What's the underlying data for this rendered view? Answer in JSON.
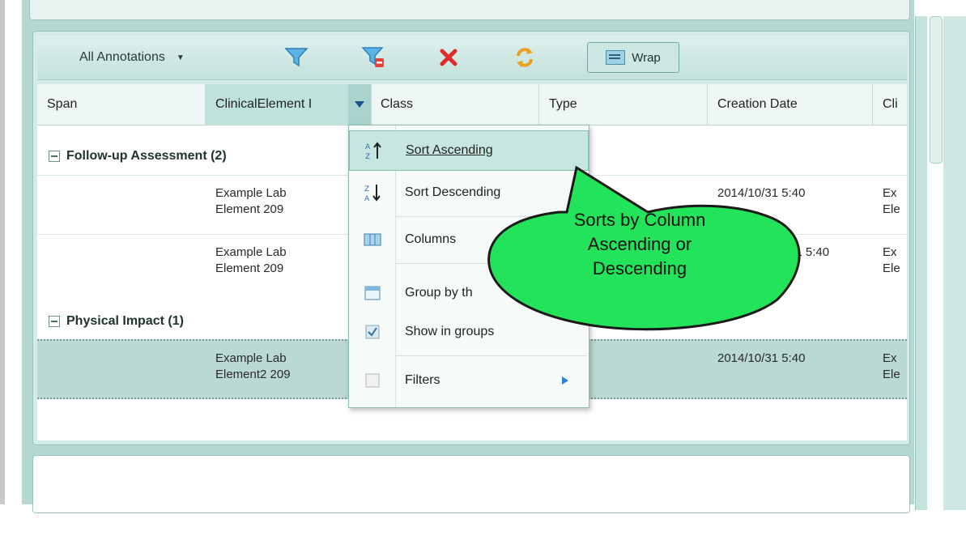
{
  "toolbar": {
    "annotation_filter": "All Annotations",
    "wrap_label": "Wrap",
    "icons": [
      "funnel-icon",
      "clear-filter-icon",
      "delete-icon",
      "refresh-icon",
      "wrap-icon"
    ]
  },
  "columns": [
    "Span",
    "ClinicalElement I",
    "Class",
    "Type",
    "Creation Date",
    "Cli"
  ],
  "groups": [
    {
      "label": "Follow-up Assessment (2)"
    },
    {
      "label": "Physical Impact (1)"
    }
  ],
  "rows": [
    {
      "clinical_line1": "Example Lab",
      "clinical_line2": "Element 209",
      "date": "2014/10/31 5:40",
      "last_line1": "Ex",
      "last_line2": "Ele"
    },
    {
      "clinical_line1": "Example Lab",
      "clinical_line2": "Element 209",
      "date": "31 5:40",
      "last_line1": "Ex",
      "last_line2": "Ele"
    },
    {
      "clinical_line1": "Example Lab",
      "clinical_line2": "Element2 209",
      "date": "2014/10/31 5:40",
      "last_line1": "Ex",
      "last_line2": "Ele"
    }
  ],
  "menu": {
    "items": [
      {
        "label": "Sort Ascending",
        "icon": "sort-ascending-icon"
      },
      {
        "label": "Sort Descending",
        "icon": "sort-descending-icon"
      },
      {
        "label": "Columns",
        "icon": "columns-icon"
      },
      {
        "label": "Group by th",
        "icon": "group-icon"
      },
      {
        "label": "Show in groups",
        "icon": "checkbox-icon",
        "checked": true
      },
      {
        "label": "Filters",
        "icon": "filters-icon"
      }
    ]
  },
  "callout": {
    "line1": "Sorts by Column",
    "line2": "Ascending or",
    "line3": "Descending",
    "color": "#22e35a"
  }
}
